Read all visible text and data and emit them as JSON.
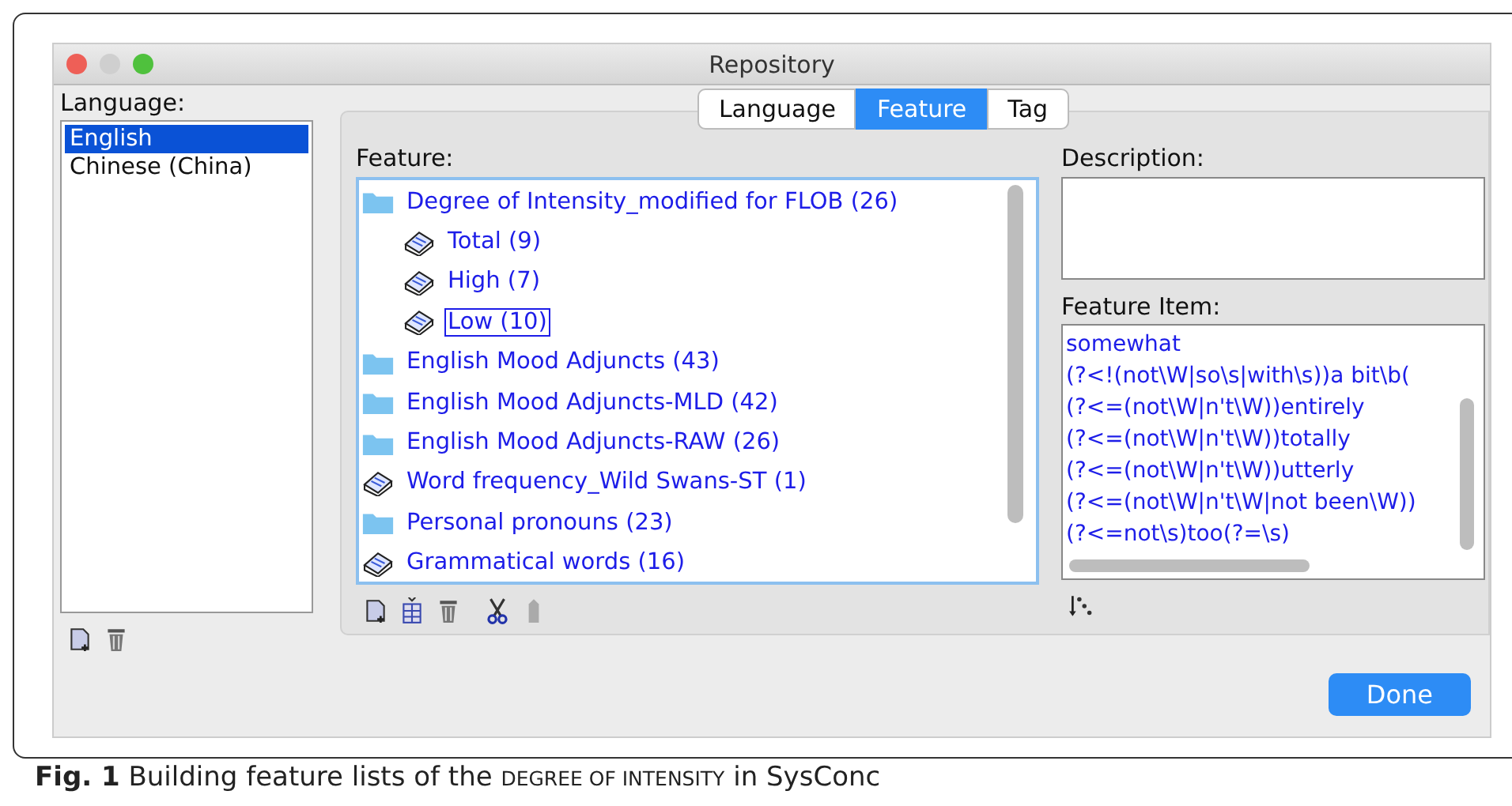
{
  "window": {
    "title": "Repository"
  },
  "language_panel": {
    "label": "Language:",
    "items": [
      {
        "label": "English",
        "selected": true
      },
      {
        "label": "Chinese (China)",
        "selected": false
      }
    ]
  },
  "tabs": [
    {
      "label": "Language",
      "selected": false
    },
    {
      "label": "Feature",
      "selected": true
    },
    {
      "label": "Tag",
      "selected": false
    }
  ],
  "feature_panel": {
    "label": "Feature:",
    "tree": [
      {
        "kind": "folder",
        "label": "Degree of Intensity_modified for FLOB (26)",
        "selected": false,
        "children": [
          {
            "kind": "book",
            "label": "Total (9)",
            "selected": false
          },
          {
            "kind": "book",
            "label": "High (7)",
            "selected": false
          },
          {
            "kind": "book",
            "label": "Low (10)",
            "selected": true
          }
        ]
      },
      {
        "kind": "folder",
        "label": "English Mood Adjuncts (43)",
        "selected": false
      },
      {
        "kind": "folder",
        "label": "English Mood Adjuncts-MLD (42)",
        "selected": false
      },
      {
        "kind": "folder",
        "label": "English Mood Adjuncts-RAW (26)",
        "selected": false
      },
      {
        "kind": "book",
        "label": "Word frequency_Wild Swans-ST (1)",
        "selected": false
      },
      {
        "kind": "folder",
        "label": "Personal pronouns (23)",
        "selected": false
      },
      {
        "kind": "book",
        "label": "Grammatical words (16)",
        "selected": false
      }
    ]
  },
  "description": {
    "label": "Description:"
  },
  "feature_item": {
    "label": "Feature Item:",
    "items": [
      "somewhat",
      "(?<!(not\\W|so\\s|with\\s))a bit\\b(",
      "(?<=(not\\W|n't\\W))entirely",
      "(?<=(not\\W|n't\\W))totally",
      "(?<=(not\\W|n't\\W))utterly",
      "(?<=(not\\W|n't\\W|not been\\W))",
      "(?<=not\\s)too(?=\\s)"
    ]
  },
  "done_button": "Done",
  "caption": {
    "label": "Fig. 1",
    "before": "Building feature lists of the",
    "term": "DEGREE OF INTENSITY",
    "after": "in SysConc"
  }
}
